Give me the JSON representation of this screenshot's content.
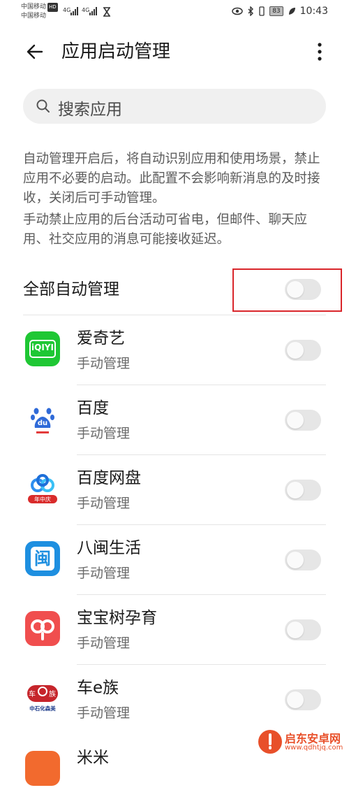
{
  "status_bar": {
    "carrier_1": "中国移动",
    "carrier_1_badge": "HD",
    "carrier_2": "中国移动",
    "net_1": "4G",
    "net_2": "4G",
    "battery": "83",
    "time": "10:43",
    "icons": [
      "signal-icon",
      "hourglass-icon",
      "eye-icon",
      "bluetooth-icon",
      "vibrate-icon",
      "battery-icon",
      "leaf-icon"
    ]
  },
  "header": {
    "title": "应用启动管理",
    "back_icon": "arrow-left-icon",
    "menu_icon": "more-vertical-icon"
  },
  "search": {
    "placeholder": "搜索应用",
    "icon": "search-icon"
  },
  "description": {
    "paragraph_1": "自动管理开启后，将自动识别应用和使用场景，禁止应用不必要的启动。此配置不会影响新消息的及时接收，关闭后可手动管理。",
    "paragraph_2": "手动禁止应用的后台活动可省电，但邮件、聊天应用、社交应用的消息可能接收延迟。"
  },
  "master_toggle": {
    "label": "全部自动管理",
    "on": false,
    "highlight_color": "#d9262b"
  },
  "apps": [
    {
      "name": "爱奇艺",
      "status": "手动管理",
      "on": false,
      "icon": "iqiyi-icon",
      "icon_text": "iQIYI",
      "icon_color": "#1fc734"
    },
    {
      "name": "百度",
      "status": "手动管理",
      "on": false,
      "icon": "baidu-paw-icon",
      "icon_text": "du",
      "icon_color": "#2f6ad8"
    },
    {
      "name": "百度网盘",
      "status": "手动管理",
      "on": false,
      "icon": "baidu-netdisk-icon",
      "icon_text": "年中庆",
      "icon_color": "#2f8ff0"
    },
    {
      "name": "八闽生活",
      "status": "手动管理",
      "on": false,
      "icon": "bamin-icon",
      "icon_text": "闽",
      "icon_color": "#1e8fe0"
    },
    {
      "name": "宝宝树孕育",
      "status": "手动管理",
      "on": false,
      "icon": "babytree-icon",
      "icon_color": "#f04e4e"
    },
    {
      "name": "车e族",
      "status": "手动管理",
      "on": false,
      "icon": "chezu-icon",
      "icon_text": "中石化森美",
      "icon_badge_left": "车",
      "icon_badge_right": "族",
      "icon_color": "#c6252b"
    },
    {
      "name": "米米",
      "status": "",
      "on": false,
      "icon": "app-icon",
      "icon_color": "#f26a2e"
    }
  ],
  "watermark": {
    "name": "启东安卓网",
    "url": "www.qdhtjq.com",
    "icon": "watermark-logo-icon"
  }
}
